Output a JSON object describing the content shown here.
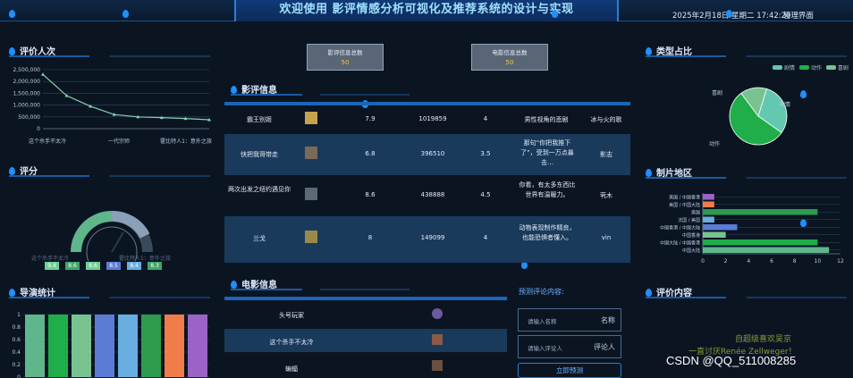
{
  "header": {
    "title": "欢迎使用 影评情感分析可视化及推荐系统的设计与实现",
    "datetime": "2025年2月18日 星期二 17:42:20",
    "manage": "管理界面"
  },
  "panels": {
    "ratings_count": "评价人次",
    "rating": "评分",
    "director_stats": "导演统计",
    "review_info": "影评信息",
    "movie_info": "电影信息",
    "type_share": "类型占比",
    "region": "制片地区",
    "review_content": "评价内容"
  },
  "stat_boxes": [
    {
      "label": "电影信息总数",
      "value": "50"
    },
    {
      "label": "影评信息总数",
      "value": "50"
    }
  ],
  "line_chart": {
    "chart_data": {
      "type": "line",
      "yticks": [
        "0",
        "500,000",
        "1,000,000",
        "1,500,000",
        "2,000,000",
        "2,500,000"
      ],
      "ylim": [
        0,
        2500000
      ],
      "xlabels": [
        "这个杀手不太冷",
        "一代宗师",
        "霍比特人1：意外之旅"
      ],
      "values": [
        2300000,
        1400000,
        950000,
        600000,
        500000,
        470000,
        430000,
        380000
      ]
    }
  },
  "gauge": {
    "text_left": "这个杀手不太冷",
    "text_mid": "霍比特人1：意外之旅",
    "badges": [
      {
        "value": "9.4",
        "color": "#6fcf97"
      },
      {
        "value": "8.6",
        "color": "#3fa66a"
      },
      {
        "value": "8.6",
        "color": "#6fcf97"
      },
      {
        "value": "8.5",
        "color": "#5b7bd5"
      },
      {
        "value": "8.4",
        "color": "#68aee0"
      },
      {
        "value": "8.3",
        "color": "#3fa66a"
      }
    ]
  },
  "bar_chart": {
    "chart_data": {
      "type": "bar",
      "yticks": [
        "0",
        "0.2",
        "0.4",
        "0.6",
        "0.8",
        "1"
      ],
      "ylim": [
        0,
        1
      ],
      "values": [
        1,
        1,
        1,
        1,
        1,
        1,
        1,
        1
      ],
      "colors": [
        "#5fb68a",
        "#1fae4a",
        "#79c391",
        "#5b7bd5",
        "#68aee0",
        "#2e9b4f",
        "#f07c4a",
        "#9b64c4"
      ]
    }
  },
  "review_table": {
    "rows": [
      {
        "movie": "霸王别姬",
        "score": "7.9",
        "votes": "1019859",
        "star": "4",
        "content": "男性视角的悲剧",
        "user": "冰与火的歌"
      },
      {
        "movie": "快把我哥带走",
        "score": "6.8",
        "votes": "396510",
        "star": "3.5",
        "content": "那句“你把我推下了”，受到一万点暴击…",
        "user": "影志"
      },
      {
        "movie": "两次出发之纽约遇见你",
        "score": "8.6",
        "votes": "438888",
        "star": "4.5",
        "content": "你看，有太多东西比世界有温暖力。",
        "user": "茕木"
      },
      {
        "movie": "兰戈",
        "score": "8",
        "votes": "149099",
        "star": "4",
        "content": "动物表现制作精良，也能恐惧者懂入。",
        "user": "vin"
      }
    ]
  },
  "movie_list": {
    "rows": [
      {
        "title": "头号玩家"
      },
      {
        "title": "这个杀手不太冷"
      },
      {
        "title": "蝙蝠"
      }
    ]
  },
  "predict_form": {
    "heading": "预测评论内容:",
    "name_placeholder": "请输入名称",
    "name_label": "名称",
    "reviewer_placeholder": "请输入评论人",
    "reviewer_label": "评论人",
    "submit": "立即预测"
  },
  "pie_chart": {
    "chart_data": {
      "type": "pie",
      "legend": [
        "剧情",
        "动作",
        "喜剧"
      ],
      "slices": [
        {
          "name": "剧情",
          "value": 30,
          "color": "#63c8b0"
        },
        {
          "name": "动作",
          "value": 55,
          "color": "#1fae4a"
        },
        {
          "name": "喜剧",
          "value": 15,
          "color": "#79c391"
        }
      ],
      "labels": {
        "a": "喜剧",
        "b": "剧情",
        "c": "动作"
      }
    }
  },
  "hbar_chart": {
    "chart_data": {
      "type": "bar",
      "categories": [
        "美国 / 中国香港",
        "美国 / 中国大陆",
        "美国",
        "法国 / 美国",
        "中国香港 / 中国大陆",
        "中国香港",
        "中国大陆 / 中国香港",
        "中国大陆"
      ],
      "values": [
        1,
        1,
        10,
        1,
        3,
        2,
        10,
        11
      ],
      "colors": [
        "#9b64c4",
        "#f07c4a",
        "#2e9b4f",
        "#68aee0",
        "#5b7bd5",
        "#79c391",
        "#1fae4a",
        "#5fb68a"
      ],
      "xticks": [
        "0",
        "2",
        "4",
        "6",
        "8",
        "10",
        "12"
      ],
      "xlim": [
        0,
        12
      ]
    }
  },
  "review_content": {
    "line1": "自超级喜欢吴京",
    "line2": "一直讨厌Renée Zellweger！"
  },
  "watermark": "CSDN @QQ_511008285"
}
